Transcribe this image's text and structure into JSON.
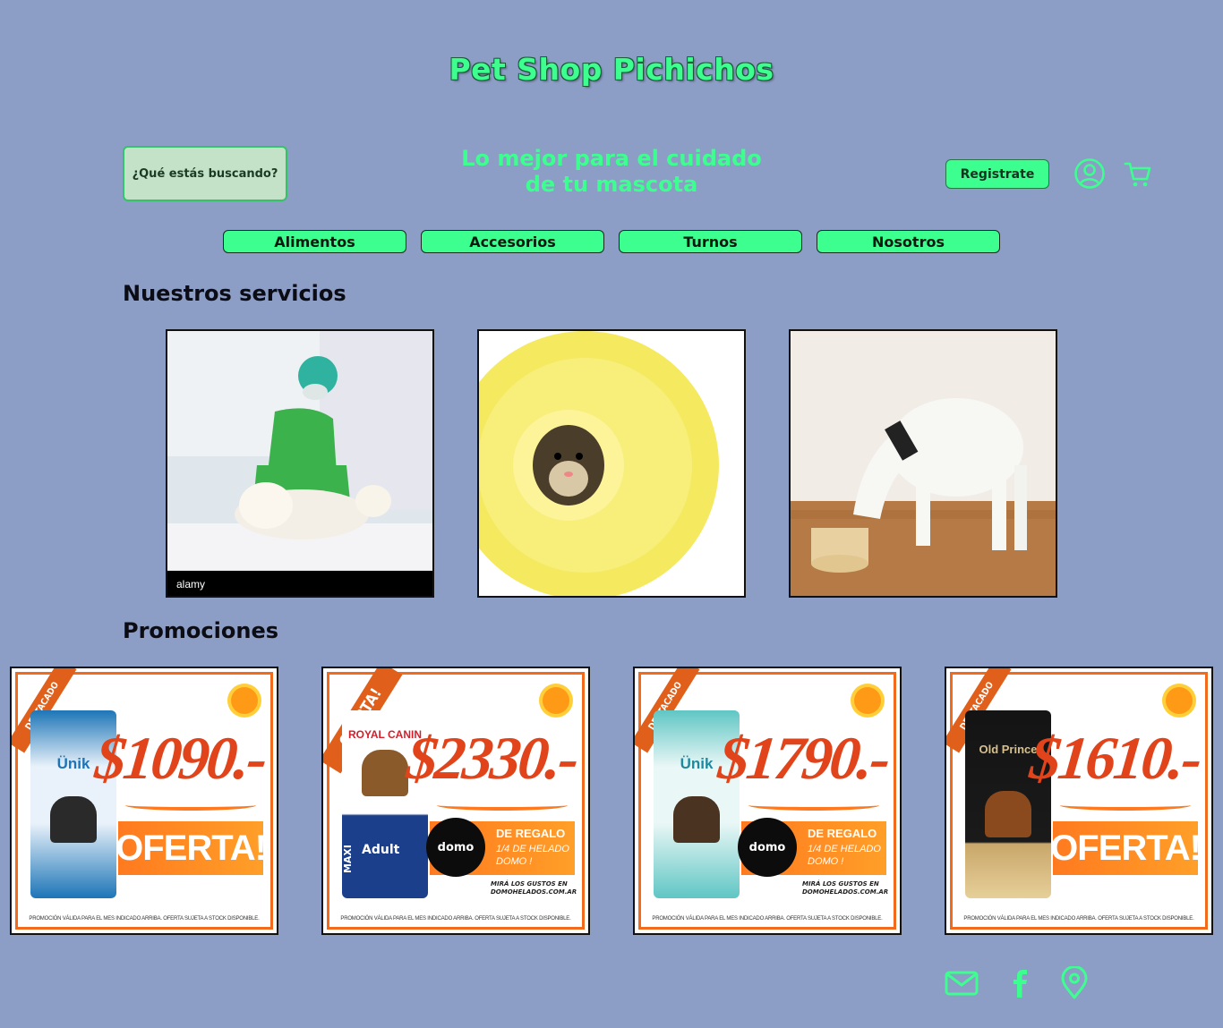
{
  "header": {
    "title": "Pet Shop Pichichos",
    "search_button": "¿Qué estás buscando?",
    "tagline_line1": "Lo mejor para el cuidado",
    "tagline_line2": "de tu mascota",
    "register_button": "Registrate",
    "user_icon": "user-circle-icon",
    "cart_icon": "shopping-cart-icon"
  },
  "nav": {
    "items": [
      {
        "label": "Alimentos"
      },
      {
        "label": "Accesorios"
      },
      {
        "label": "Turnos"
      },
      {
        "label": "Nosotros"
      }
    ]
  },
  "services": {
    "title": "Nuestros servicios",
    "images": [
      {
        "icon": "veterinarian-photo",
        "watermark": "alamy"
      },
      {
        "icon": "hamster-ball-photo"
      },
      {
        "icon": "dog-eating-photo"
      }
    ]
  },
  "promotions": {
    "title": "Promociones",
    "cards": [
      {
        "ribbon": "DESTACADO",
        "price": "$1090.-",
        "brand": "Ünik",
        "oferta": "OFERTA!",
        "fine_print": "PROMOCIÓN VÁLIDA PARA EL MES INDICADO ARRIBA. OFERTA SUJETA A STOCK DISPONIBLE."
      },
      {
        "ribbon": "OFERTA!",
        "price": "$2330.-",
        "brand": "ROYAL CANIN",
        "bag_label": "Adult",
        "bag_side": "MAXI",
        "regalo_title": "DE REGALO",
        "regalo_sub1": "1/4 DE HELADO",
        "regalo_sub2": "DOMO !",
        "domo": "domo",
        "regalo_web1": "MIRÁ LOS GUSTOS EN",
        "regalo_web2": "DOMOHELADOS.COM.AR",
        "fine_print": "PROMOCIÓN VÁLIDA PARA EL MES INDICADO ARRIBA. OFERTA SUJETA A STOCK DISPONIBLE."
      },
      {
        "ribbon": "DESTACADO",
        "price": "$1790.-",
        "brand": "Ünik",
        "regalo_title": "DE REGALO",
        "regalo_sub1": "1/4 DE HELADO",
        "regalo_sub2": "DOMO !",
        "domo": "domo",
        "regalo_web1": "MIRÁ LOS GUSTOS EN",
        "regalo_web2": "DOMOHELADOS.COM.AR",
        "fine_print": "PROMOCIÓN VÁLIDA PARA EL MES INDICADO ARRIBA. OFERTA SUJETA A STOCK DISPONIBLE."
      },
      {
        "ribbon": "DESTACADO",
        "price": "$1610.-",
        "brand": "Old Prince",
        "oferta": "OFERTA!",
        "fine_print": "PROMOCIÓN VÁLIDA PARA EL MES INDICADO ARRIBA. OFERTA SUJETA A STOCK DISPONIBLE."
      }
    ]
  },
  "footer": {
    "icons": [
      "mail-icon",
      "facebook-icon",
      "location-pin-icon"
    ]
  },
  "colors": {
    "background": "#8c9dc6",
    "accent_green": "#3dff8f",
    "promo_orange": "#f26a1b"
  }
}
